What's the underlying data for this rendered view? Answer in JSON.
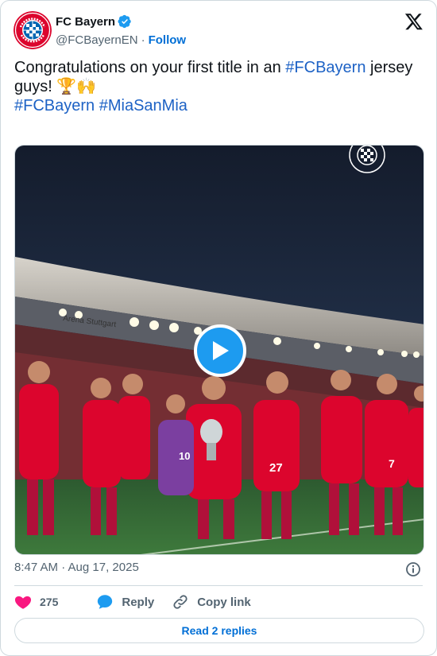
{
  "author": {
    "display_name": "FC Bayern",
    "handle": "@FCBayernEN",
    "separator": "·",
    "follow_label": "Follow",
    "verified_icon": "verified-badge-icon",
    "avatar_icon": "fc-bayern-crest-icon"
  },
  "tweet": {
    "text_before": "Congratulations on your first title in an ",
    "hashtag_inline": "#FCBayern",
    "text_after": " jersey guys! 🏆🙌",
    "hashtag_1": "#FCBayern",
    "hashtag_2": "#MiaSanMia"
  },
  "media": {
    "type": "video",
    "scene": "stadium",
    "stadium_sign": "Arena Stuttgart",
    "play_icon": "play-icon",
    "watermark_icon": "fc-bayern-crest-watermark-icon",
    "jersey_numbers": [
      "10",
      "27",
      "7"
    ]
  },
  "meta": {
    "timestamp": "8:47 AM · Aug 17, 2025",
    "info_icon": "info-icon"
  },
  "actions": {
    "like_count": "275",
    "reply_label": "Reply",
    "copy_label": "Copy link"
  },
  "footer": {
    "read_replies_label": "Read 2 replies"
  },
  "colors": {
    "link_blue": "#1d62c5",
    "follow_blue": "#006fd6",
    "verified_blue": "#1d9bf0",
    "like_pink": "#f91880",
    "border": "#cfd9de",
    "bayern_red": "#dc052d"
  }
}
